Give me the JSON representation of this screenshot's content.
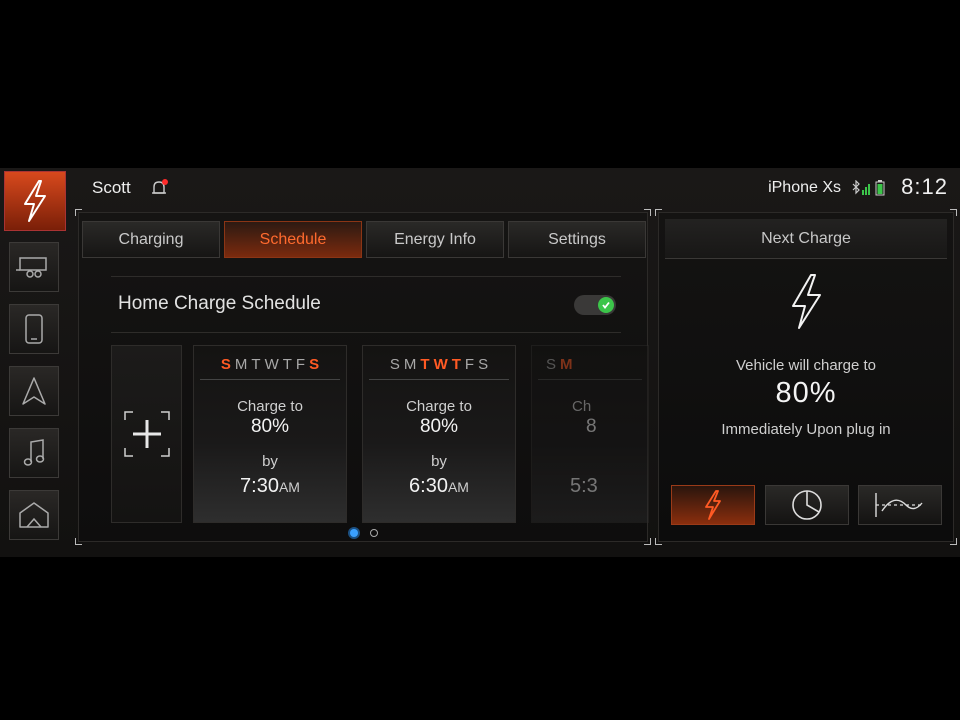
{
  "status": {
    "user": "Scott",
    "phone": "iPhone Xs",
    "time": "8:12"
  },
  "sidebar": {
    "items": [
      {
        "icon": "lightning-icon",
        "active": true
      },
      {
        "icon": "trailer-icon",
        "active": false
      },
      {
        "icon": "phone-icon",
        "active": false
      },
      {
        "icon": "navigation-icon",
        "active": false
      },
      {
        "icon": "music-icon",
        "active": false
      },
      {
        "icon": "home-icon",
        "active": false
      }
    ]
  },
  "tabs": [
    {
      "label": "Charging",
      "active": false
    },
    {
      "label": "Schedule",
      "active": true
    },
    {
      "label": "Energy Info",
      "active": false
    },
    {
      "label": "Settings",
      "active": false
    }
  ],
  "schedule": {
    "title": "Home Charge Schedule",
    "enabled": true,
    "cards": [
      {
        "days": [
          {
            "d": "S",
            "on": true
          },
          {
            "d": "M",
            "on": false
          },
          {
            "d": "T",
            "on": false
          },
          {
            "d": "W",
            "on": false
          },
          {
            "d": "T",
            "on": false
          },
          {
            "d": "F",
            "on": false
          },
          {
            "d": "S",
            "on": true
          }
        ],
        "charge_label": "Charge to",
        "percent": "80%",
        "by_label": "by",
        "time": "7:30",
        "ampm": "AM"
      },
      {
        "days": [
          {
            "d": "S",
            "on": false
          },
          {
            "d": "M",
            "on": false
          },
          {
            "d": "T",
            "on": true
          },
          {
            "d": "W",
            "on": true
          },
          {
            "d": "T",
            "on": true
          },
          {
            "d": "F",
            "on": false
          },
          {
            "d": "S",
            "on": false
          }
        ],
        "charge_label": "Charge to",
        "percent": "80%",
        "by_label": "by",
        "time": "6:30",
        "ampm": "AM"
      },
      {
        "days": [
          {
            "d": "S",
            "on": false
          },
          {
            "d": "M",
            "on": true
          }
        ],
        "charge_label": "Ch",
        "percent": "8",
        "time": "5:3"
      }
    ],
    "page_index": 0,
    "page_count": 2
  },
  "next_charge": {
    "title": "Next Charge",
    "line1": "Vehicle will charge to",
    "percent": "80%",
    "line2": "Immediately Upon plug in",
    "buttons": [
      {
        "icon": "lightning-icon",
        "active": true
      },
      {
        "icon": "pie-chart-icon",
        "active": false
      },
      {
        "icon": "rate-curve-icon",
        "active": false
      }
    ]
  },
  "colors": {
    "accent": "#ff5a24",
    "toggle_on": "#3cc54a",
    "page_dot_active": "#3aa0ff"
  }
}
